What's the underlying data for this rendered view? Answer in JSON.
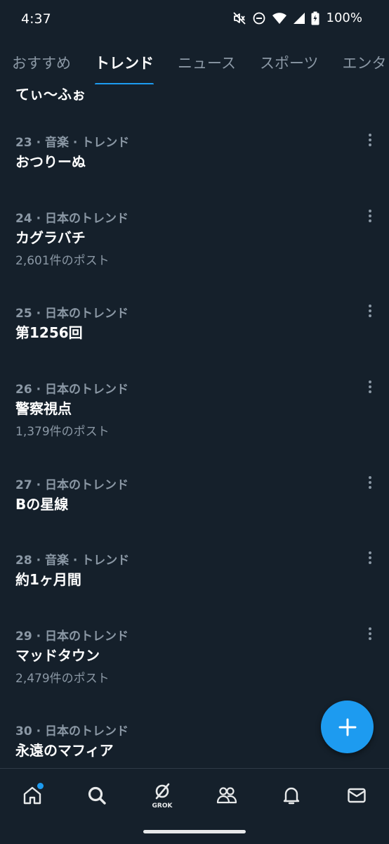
{
  "status_bar": {
    "time": "4:37",
    "battery": "100%",
    "icons": [
      "mute-icon",
      "dnd-icon",
      "wifi-icon",
      "signal-icon",
      "battery-icon"
    ]
  },
  "tabs": [
    {
      "label": "おすすめ",
      "active": false
    },
    {
      "label": "トレンド",
      "active": true
    },
    {
      "label": "ニュース",
      "active": false
    },
    {
      "label": "スポーツ",
      "active": false
    },
    {
      "label": "エンタ",
      "active": false
    }
  ],
  "partial_trend_title": "てぃ〜ふぉ",
  "trends": [
    {
      "meta": "23 · 音楽 · トレンド",
      "title": "おつりーぬ",
      "count": ""
    },
    {
      "meta": "24 · 日本のトレンド",
      "title": "カグラバチ",
      "count": "2,601件のポスト"
    },
    {
      "meta": "25 · 日本のトレンド",
      "title": "第1256回",
      "count": ""
    },
    {
      "meta": "26 · 日本のトレンド",
      "title": "警察視点",
      "count": "1,379件のポスト"
    },
    {
      "meta": "27 · 日本のトレンド",
      "title": "Bの星線",
      "count": ""
    },
    {
      "meta": "28 · 音楽 · トレンド",
      "title": "約1ヶ月間",
      "count": ""
    },
    {
      "meta": "29 · 日本のトレンド",
      "title": "マッドタウン",
      "count": "2,479件のポスト"
    },
    {
      "meta": "30 · 日本のトレンド",
      "title": "永遠のマフィア",
      "count": ""
    }
  ],
  "fab": {
    "icon": "plus-icon"
  },
  "bottom_nav": [
    {
      "icon": "home-icon",
      "badge": true
    },
    {
      "icon": "search-icon",
      "badge": false
    },
    {
      "icon": "grok-icon",
      "label": "GROK",
      "badge": false
    },
    {
      "icon": "communities-icon",
      "badge": false
    },
    {
      "icon": "bell-icon",
      "badge": false
    },
    {
      "icon": "mail-icon",
      "badge": false
    }
  ],
  "colors": {
    "background": "#15202b",
    "accent": "#1d9bf0",
    "secondary_text": "#8b98a5",
    "primary_text": "#ffffff"
  }
}
